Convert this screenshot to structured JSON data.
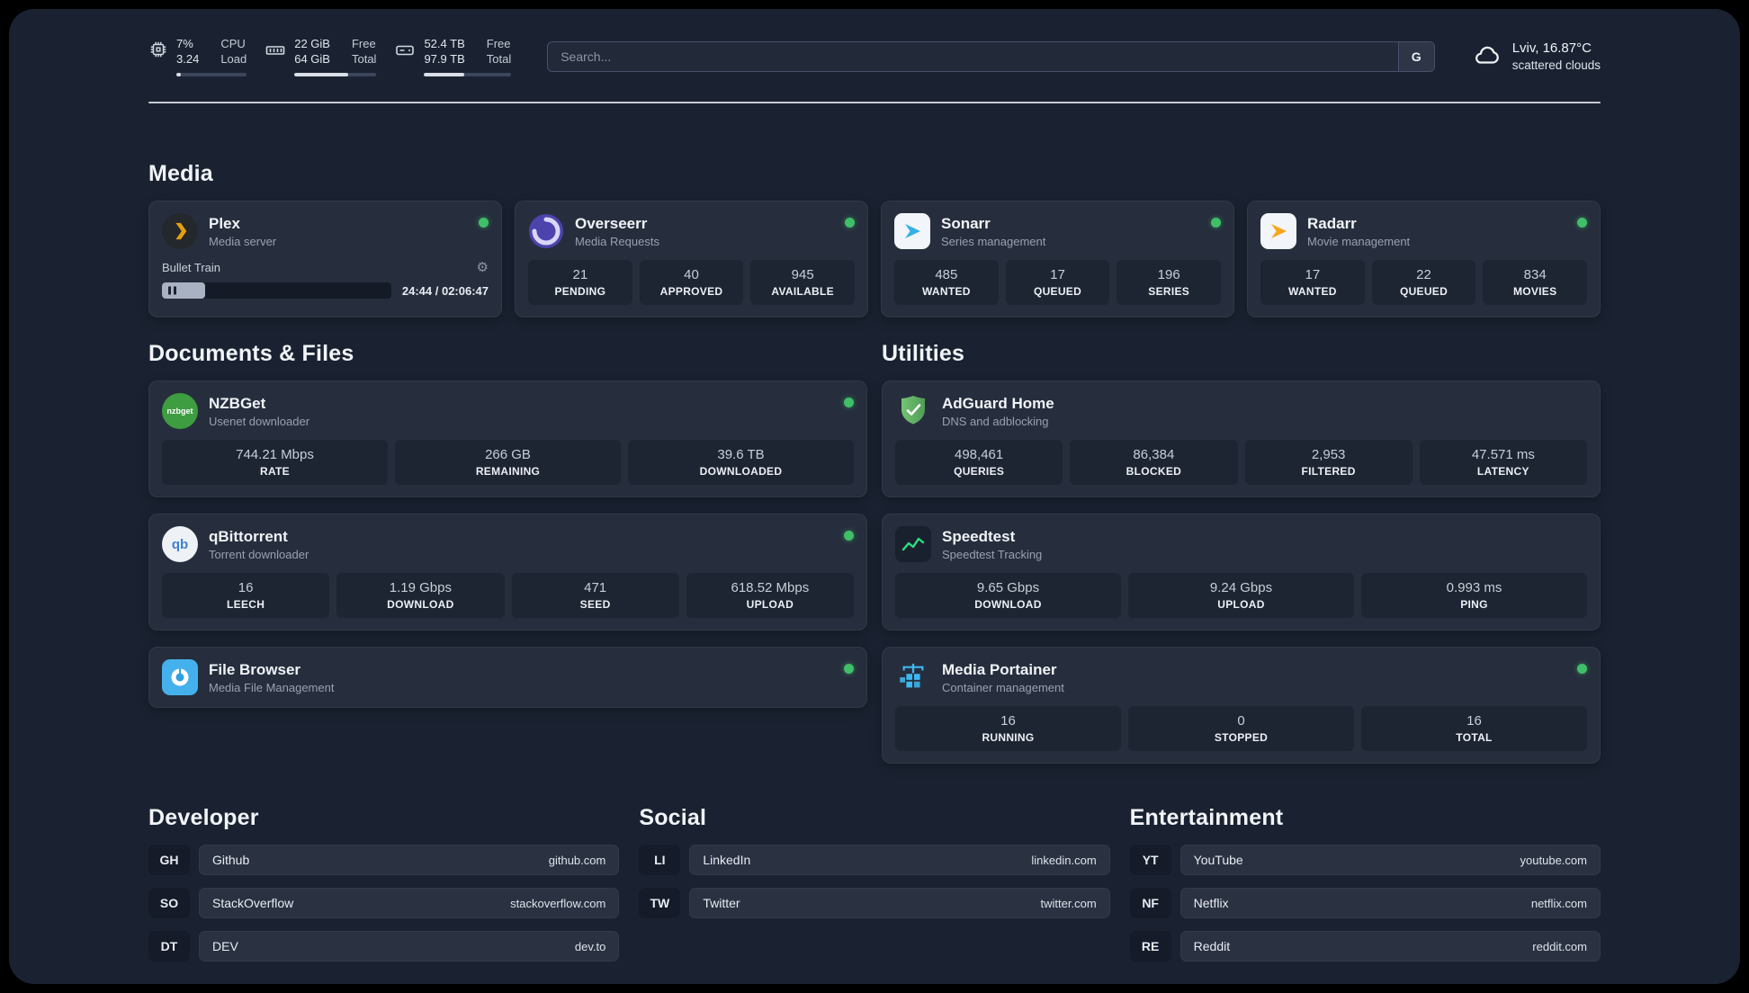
{
  "header": {
    "cpu": {
      "percent": "7%",
      "load": "3.24",
      "label_top": "CPU",
      "label_bottom": "Load",
      "fill_style": "width:7%"
    },
    "ram": {
      "free": "22 GiB",
      "total": "64 GiB",
      "label_top": "Free",
      "label_bottom": "Total",
      "fill_style": "width:66%"
    },
    "disk": {
      "free": "52.4 TB",
      "total": "97.9 TB",
      "label_top": "Free",
      "label_bottom": "Total",
      "fill_style": "width:46%"
    },
    "search": {
      "placeholder": "Search...",
      "engine": "G"
    },
    "weather": {
      "location": "Lviv, 16.87°C",
      "condition": "scattered clouds"
    }
  },
  "sections": {
    "media": "Media",
    "documents": "Documents & Files",
    "utilities": "Utilities",
    "developer": "Developer",
    "social": "Social",
    "entertainment": "Entertainment"
  },
  "apps": {
    "plex": {
      "name": "Plex",
      "desc": "Media server",
      "now_playing": "Bullet Train",
      "time": "24:44 / 02:06:47",
      "progress_style": "width:19%"
    },
    "overseerr": {
      "name": "Overseerr",
      "desc": "Media Requests",
      "stats": [
        {
          "value": "21",
          "label": "PENDING"
        },
        {
          "value": "40",
          "label": "APPROVED"
        },
        {
          "value": "945",
          "label": "AVAILABLE"
        }
      ]
    },
    "sonarr": {
      "name": "Sonarr",
      "desc": "Series management",
      "stats": [
        {
          "value": "485",
          "label": "WANTED"
        },
        {
          "value": "17",
          "label": "QUEUED"
        },
        {
          "value": "196",
          "label": "SERIES"
        }
      ]
    },
    "radarr": {
      "name": "Radarr",
      "desc": "Movie management",
      "stats": [
        {
          "value": "17",
          "label": "WANTED"
        },
        {
          "value": "22",
          "label": "QUEUED"
        },
        {
          "value": "834",
          "label": "MOVIES"
        }
      ]
    },
    "nzbget": {
      "name": "NZBGet",
      "desc": "Usenet downloader",
      "icon_text": "nzbget",
      "stats": [
        {
          "value": "744.21 Mbps",
          "label": "RATE"
        },
        {
          "value": "266 GB",
          "label": "REMAINING"
        },
        {
          "value": "39.6 TB",
          "label": "DOWNLOADED"
        }
      ]
    },
    "qbittorrent": {
      "name": "qBittorrent",
      "desc": "Torrent downloader",
      "icon_text": "qb",
      "stats": [
        {
          "value": "16",
          "label": "LEECH"
        },
        {
          "value": "1.19 Gbps",
          "label": "DOWNLOAD"
        },
        {
          "value": "471",
          "label": "SEED"
        },
        {
          "value": "618.52 Mbps",
          "label": "UPLOAD"
        }
      ]
    },
    "filebrowser": {
      "name": "File Browser",
      "desc": "Media File Management"
    },
    "adguard": {
      "name": "AdGuard Home",
      "desc": "DNS and adblocking",
      "stats": [
        {
          "value": "498,461",
          "label": "QUERIES"
        },
        {
          "value": "86,384",
          "label": "BLOCKED"
        },
        {
          "value": "2,953",
          "label": "FILTERED"
        },
        {
          "value": "47.571 ms",
          "label": "LATENCY"
        }
      ]
    },
    "speedtest": {
      "name": "Speedtest",
      "desc": "Speedtest Tracking",
      "stats": [
        {
          "value": "9.65 Gbps",
          "label": "DOWNLOAD"
        },
        {
          "value": "9.24 Gbps",
          "label": "UPLOAD"
        },
        {
          "value": "0.993 ms",
          "label": "PING"
        }
      ]
    },
    "portainer": {
      "name": "Media Portainer",
      "desc": "Container management",
      "stats": [
        {
          "value": "16",
          "label": "RUNNING"
        },
        {
          "value": "0",
          "label": "STOPPED"
        },
        {
          "value": "16",
          "label": "TOTAL"
        }
      ]
    }
  },
  "bookmarks": {
    "developer": [
      {
        "abbr": "GH",
        "name": "Github",
        "url": "github.com"
      },
      {
        "abbr": "SO",
        "name": "StackOverflow",
        "url": "stackoverflow.com"
      },
      {
        "abbr": "DT",
        "name": "DEV",
        "url": "dev.to"
      }
    ],
    "social": [
      {
        "abbr": "LI",
        "name": "LinkedIn",
        "url": "linkedin.com"
      },
      {
        "abbr": "TW",
        "name": "Twitter",
        "url": "twitter.com"
      }
    ],
    "entertainment": [
      {
        "abbr": "YT",
        "name": "YouTube",
        "url": "youtube.com"
      },
      {
        "abbr": "NF",
        "name": "Netflix",
        "url": "netflix.com"
      },
      {
        "abbr": "RE",
        "name": "Reddit",
        "url": "reddit.com"
      }
    ]
  },
  "colors": {
    "status_online": "#3fbf68",
    "panel_bg": "#1a2231",
    "card_bg": "#262e3d",
    "tile_bg": "#1d2532"
  }
}
